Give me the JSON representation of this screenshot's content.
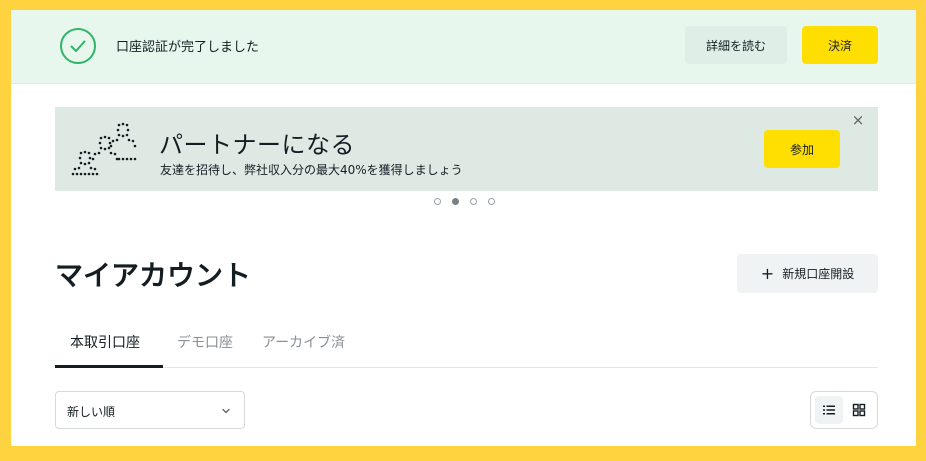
{
  "notice": {
    "message": "口座認証が完了しました",
    "details_label": "詳細を読む",
    "pay_label": "決済",
    "icon": "check-circle-icon",
    "accent": "#2fb566"
  },
  "banner": {
    "title": "パートナーになる",
    "subtitle": "友達を招待し、弊社収入分の最大40%を獲得しましょう",
    "join_label": "参加",
    "close_label": "×",
    "slides": 4,
    "active_slide": 2
  },
  "page": {
    "title": "マイアカウント",
    "new_account_label": "新規口座開設",
    "plus_symbol": "+"
  },
  "tabs": [
    {
      "label": "本取引口座",
      "active": true
    },
    {
      "label": "デモ口座",
      "active": false
    },
    {
      "label": "アーカイブ済",
      "active": false
    }
  ],
  "sort": {
    "selected": "新しい順"
  },
  "view_toggle": {
    "active": "list"
  },
  "colors": {
    "brand_yellow": "#ffde02",
    "frame_yellow": "#ffd23f",
    "notice_bg": "#e8f7ee",
    "banner_bg": "#dfe9e4",
    "text": "#141d22"
  }
}
